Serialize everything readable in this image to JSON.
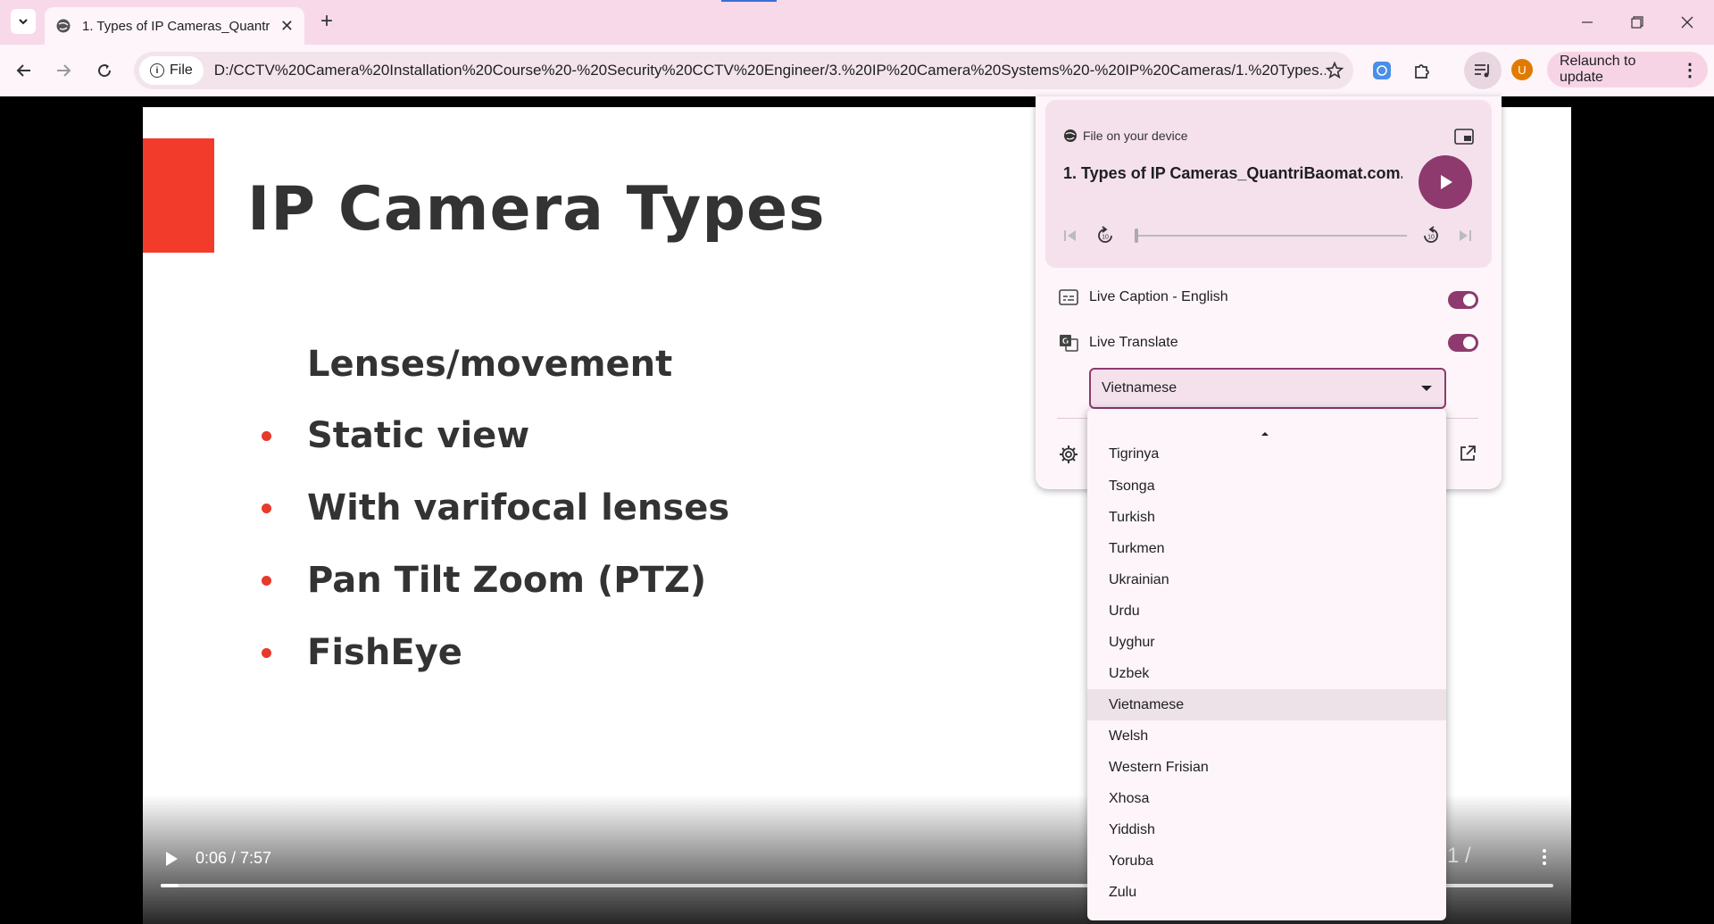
{
  "browser": {
    "tab_title": "1. Types of IP Cameras_QuantriBaomat.com",
    "address_chip": "File",
    "url": "D:/CCTV%20Camera%20Installation%20Course%20-%20Security%20CCTV%20Engineer/3.%20IP%20Camera%20Systems%20-%20IP%20Cameras/1.%20Types...",
    "avatar_letter": "U",
    "relaunch_label": "Relaunch to update"
  },
  "slide": {
    "title": "IP Camera Types",
    "subtitle": "Lenses/movement",
    "bullets": [
      "Static view",
      "With varifocal lenses",
      "Pan Tilt Zoom (PTZ)",
      "FishEye"
    ]
  },
  "video_controls": {
    "time": "0:06 / 7:57",
    "progress_fraction": 0.013,
    "right_text": "1 /"
  },
  "media_panel": {
    "source_label": "File on your device",
    "media_title": "1. Types of IP Cameras_QuantriBaomat.com...",
    "live_caption_label": "Live Caption - English",
    "live_caption_on": true,
    "live_translate_label": "Live Translate",
    "live_translate_on": true,
    "selected_language": "Vietnamese",
    "accent_color": "#8e3a6e"
  },
  "language_dropdown": {
    "items": [
      "Tigrinya",
      "Tsonga",
      "Turkish",
      "Turkmen",
      "Ukrainian",
      "Urdu",
      "Uyghur",
      "Uzbek",
      "Vietnamese",
      "Welsh",
      "Western Frisian",
      "Xhosa",
      "Yiddish",
      "Yoruba",
      "Zulu"
    ],
    "selected": "Vietnamese"
  }
}
